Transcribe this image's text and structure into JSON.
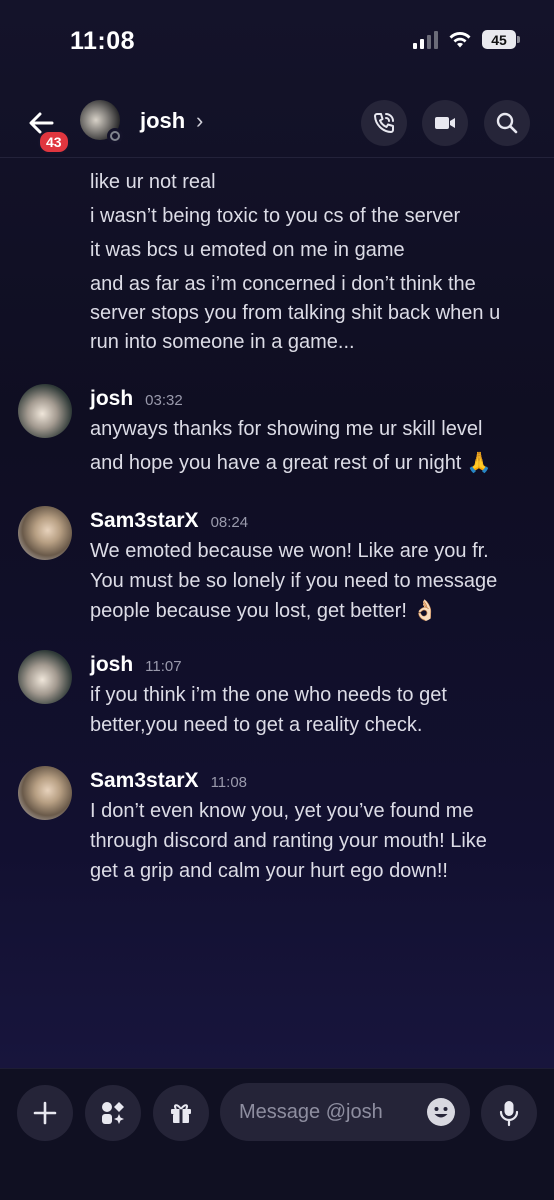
{
  "status_bar": {
    "time": "11:08",
    "battery": "45"
  },
  "header": {
    "badge": "43",
    "name": "josh",
    "chevron": "›"
  },
  "continuation_lines": [
    "like ur not real",
    "i wasn’t being toxic to you cs of the server",
    "it was bcs u emoted on me in game",
    "and as far as i’m concerned i don’t think the",
    "server stops you from talking shit back when u",
    "run into someone in a game..."
  ],
  "messages": [
    {
      "author": "josh",
      "time": "03:32",
      "lines": [
        "anyways thanks for showing me ur skill level",
        "and hope you have a great rest of ur night 🙏"
      ]
    },
    {
      "author": "Sam3starX",
      "time": "08:24",
      "lines": [
        "We emoted because we won! Like are you fr.",
        "You must be so lonely if you need to message",
        "people because you lost, get better! 👌🏻"
      ]
    },
    {
      "author": "josh",
      "time": "11:07",
      "lines": [
        "if you think i’m the one who needs to get",
        "better,you need to get a reality check."
      ]
    },
    {
      "author": "Sam3starX",
      "time": "11:08",
      "lines": [
        "I don’t even know you, yet you’ve found me",
        "through discord and ranting your mouth! Like",
        "get a grip and calm your hurt ego down!!"
      ]
    }
  ],
  "composer": {
    "placeholder": "Message @josh"
  },
  "icons": {
    "back": "arrow-left-icon",
    "call": "phone-icon",
    "video": "video-camera-icon",
    "search": "search-icon",
    "add": "plus-icon",
    "apps": "apps-icon",
    "gift": "gift-icon",
    "emoji": "smiley-icon",
    "mic": "microphone-icon"
  }
}
